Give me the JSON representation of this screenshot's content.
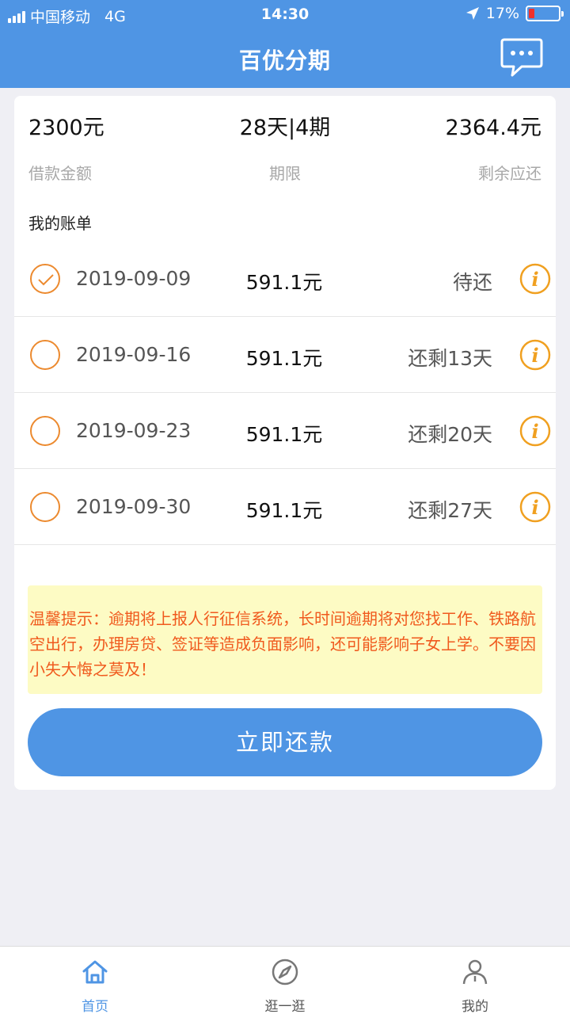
{
  "status_bar": {
    "carrier": "中国移动",
    "network": "4G",
    "time": "14:30",
    "battery": "17%"
  },
  "header": {
    "title": "百优分期",
    "message_icon": "chat-bubble-icon"
  },
  "summary": {
    "amount_value": "2300元",
    "amount_label": "借款金额",
    "term_value": "28天|4期",
    "term_label": "期限",
    "remaining_value": "2364.4元",
    "remaining_label": "剩余应还"
  },
  "bills": {
    "title": "我的账单",
    "rows": [
      {
        "date": "2019-09-09",
        "amount": "591.1元",
        "status": "待还",
        "checked": true
      },
      {
        "date": "2019-09-16",
        "amount": "591.1元",
        "status": "还剩13天",
        "checked": false
      },
      {
        "date": "2019-09-23",
        "amount": "591.1元",
        "status": "还剩20天",
        "checked": false
      },
      {
        "date": "2019-09-30",
        "amount": "591.1元",
        "status": "还剩27天",
        "checked": false
      }
    ]
  },
  "notice": "温馨提示：逾期将上报人行征信系统，长时间逾期将对您找工作、铁路航空出行，办理房贷、签证等造成负面影响，还可能影响子女上学。不要因小失大悔之莫及！",
  "pay_button": "立即还款",
  "tabbar": {
    "items": [
      {
        "label": "首页",
        "icon": "home-icon",
        "active": true
      },
      {
        "label": "逛一逛",
        "icon": "compass-icon",
        "active": false
      },
      {
        "label": "我的",
        "icon": "user-icon",
        "active": false
      }
    ]
  },
  "colors": {
    "primary": "#4f95e4",
    "accent": "#ec8a2f",
    "notice_text": "#f05a1e",
    "notice_bg": "#fdfbc4"
  }
}
